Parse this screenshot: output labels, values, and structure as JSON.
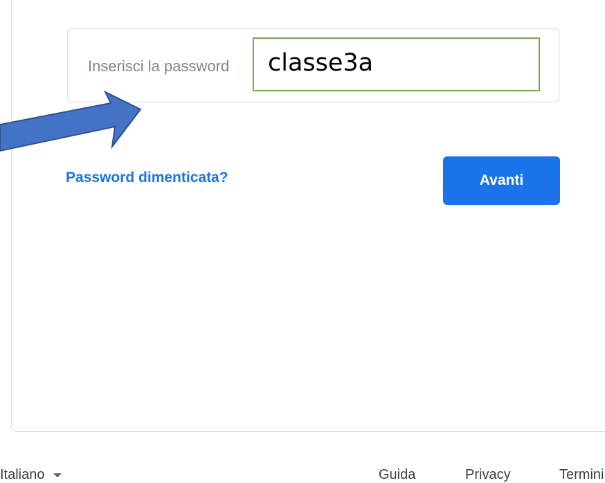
{
  "password": {
    "placeholder": "Inserisci la password",
    "typed_value": "classe3a"
  },
  "actions": {
    "forgot_label": "Password dimenticata?",
    "next_label": "Avanti"
  },
  "footer": {
    "language": "Italiano",
    "links": [
      "Guida",
      "Privacy",
      "Termini"
    ]
  },
  "colors": {
    "accent": "#1a73e8",
    "annotation_arrow": "#4472c4",
    "annotation_box_border": "#70ad47"
  }
}
